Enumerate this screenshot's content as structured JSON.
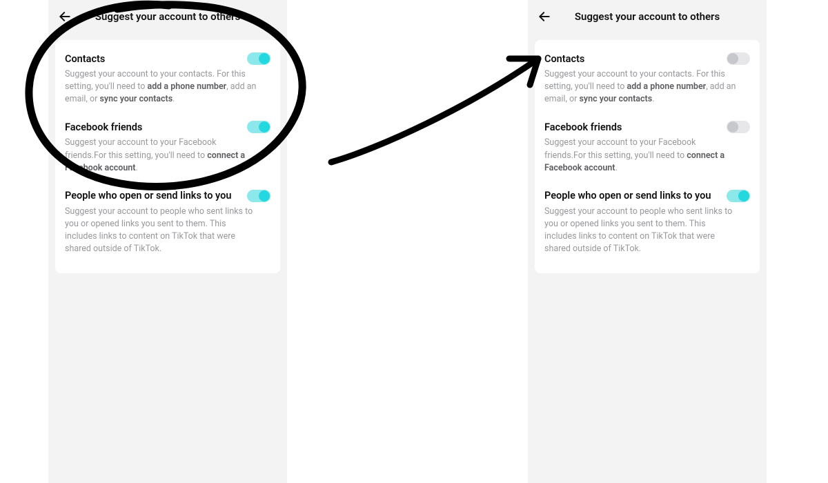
{
  "header": {
    "title": "Suggest your account to others"
  },
  "rows": {
    "contacts": {
      "title": "Contacts",
      "desc_pre": "Suggest your account to your contacts. For this setting, you'll need to ",
      "link1": "add a phone number",
      "desc_mid": ", add an email, or ",
      "link2": "sync your contacts",
      "desc_post": "."
    },
    "facebook": {
      "title": "Facebook friends",
      "desc_pre": "Suggest your account to your Facebook friends.For this setting, you'll need to ",
      "link1": "connect a Facebook account",
      "desc_post": "."
    },
    "links": {
      "title": "People who open or send links to you",
      "desc": "Suggest your account to people who sent links to you or opened links you sent to them. This includes links to content on TikTok that were shared outside of TikTok."
    }
  },
  "left_state": {
    "contacts_on": "on",
    "facebook_on": "on",
    "links_on": "on"
  },
  "right_state": {
    "contacts_on": "off",
    "facebook_on": "off",
    "links_on": "on"
  }
}
